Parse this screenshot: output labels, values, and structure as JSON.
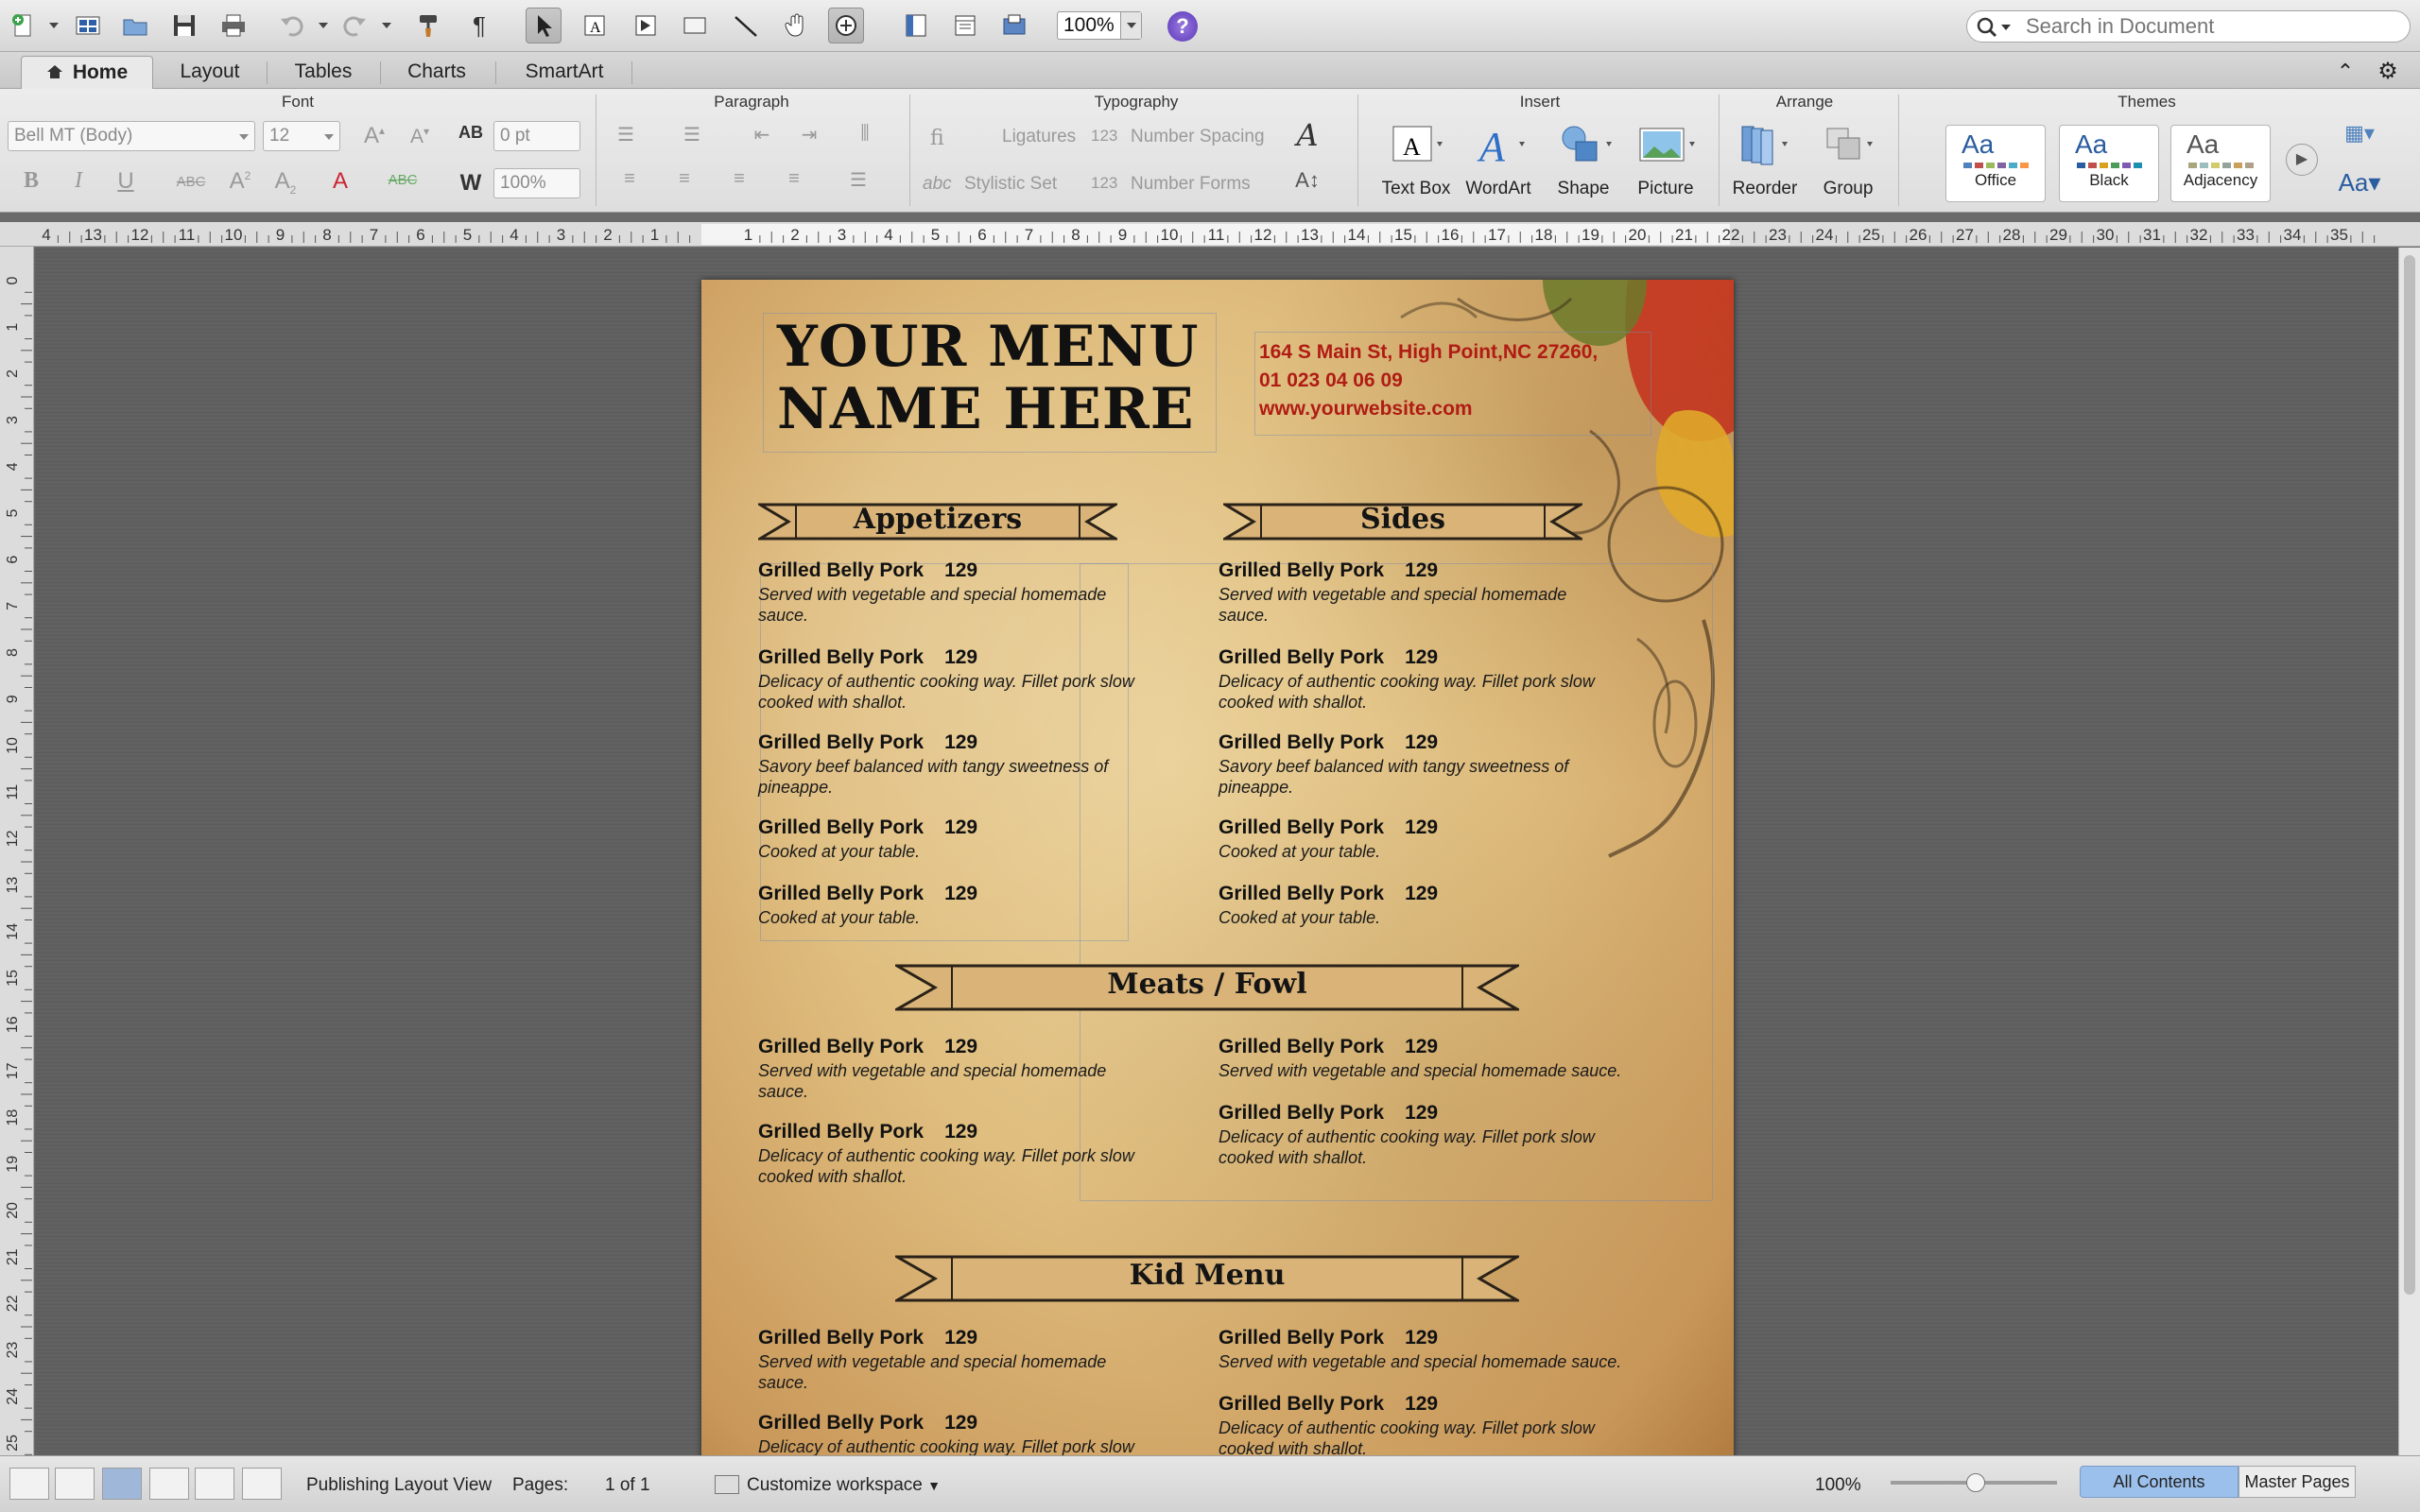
{
  "toolbar": {
    "zoom": "100%",
    "search_placeholder": "Search in Document",
    "help": "?"
  },
  "tabs": [
    "Home",
    "Layout",
    "Tables",
    "Charts",
    "SmartArt"
  ],
  "ribbon": {
    "groups": {
      "font": "Font",
      "paragraph": "Paragraph",
      "typography": "Typography",
      "insert": "Insert",
      "arrange": "Arrange",
      "themes": "Themes"
    },
    "font_name": "Bell MT (Body)",
    "font_size": "12",
    "char_spacing": "0 pt",
    "scale": "100%",
    "ligatures": "Ligatures",
    "number_spacing": "Number Spacing",
    "stylistic_set": "Stylistic Set",
    "number_forms": "Number Forms",
    "insert_buttons": [
      "Text Box",
      "WordArt",
      "Shape",
      "Picture"
    ],
    "arrange_buttons": [
      "Reorder",
      "Group"
    ],
    "themes": [
      "Office",
      "Black",
      "Adjacency"
    ],
    "theme_sample": "Aa"
  },
  "ruler": {
    "h_left": [
      "4",
      "13",
      "12",
      "11",
      "10",
      "9",
      "8",
      "7",
      "6",
      "5",
      "4",
      "3",
      "2",
      "1"
    ],
    "h_right": [
      "1",
      "2",
      "3",
      "4",
      "5",
      "6",
      "7",
      "8",
      "9",
      "10",
      "11",
      "12",
      "13",
      "14",
      "15",
      "16",
      "17",
      "18",
      "19",
      "20",
      "21",
      "22",
      "23",
      "24",
      "25",
      "26",
      "27",
      "28",
      "29",
      "30",
      "31",
      "32",
      "33",
      "34",
      "35"
    ],
    "v": [
      "0",
      "1",
      "2",
      "3",
      "4",
      "5",
      "6",
      "7",
      "8",
      "9",
      "10",
      "11",
      "12",
      "13",
      "14",
      "15",
      "16",
      "17",
      "18",
      "19",
      "20",
      "21",
      "22",
      "23",
      "24",
      "25"
    ]
  },
  "document": {
    "title_line1": "YOUR MENU",
    "title_line2": "NAME HERE",
    "address": "164 S Main St, High Point,NC 27260,",
    "phone": "01 023 04 06 09",
    "website": "www.yourwebsite.com",
    "sections": {
      "appetizers": "Appetizers",
      "sides": "Sides",
      "meats": "Meats / Fowl",
      "kids": "Kid Menu"
    },
    "item_name": "Grilled Belly Pork",
    "item_price": "129",
    "desc": {
      "served": "Served with vegetable and special homemade sauce.",
      "delicacy": "Delicacy of authentic cooking way. Fillet pork slow cooked with shallot.",
      "savory": "Savory beef balanced with tangy sweetness of pineappe.",
      "cooked": "Cooked at your table."
    }
  },
  "status": {
    "view": "Publishing Layout View",
    "pages_label": "Pages:",
    "pages_value": "1 of 1",
    "workspace": "Customize workspace",
    "zoom": "100%",
    "all_contents": "All Contents",
    "master_pages": "Master Pages"
  },
  "colors": {
    "contact_red": "#b01c14",
    "accent_blue": "#2a5d9f"
  }
}
